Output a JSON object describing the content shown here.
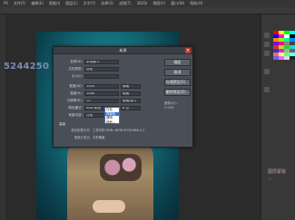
{
  "menu": [
    "PS",
    "文件(F)",
    "编辑(E)",
    "图像(I)",
    "图层(L)",
    "文字(Y)",
    "选择(S)",
    "滤镜(T)",
    "3D(D)",
    "视图(V)",
    "窗口(W)",
    "帮助(H)"
  ],
  "watermark_left": "5244250",
  "right_panel_text": "图层蒙版",
  "right_panel_subtext": "—",
  "dialog": {
    "title": "新建",
    "fields": [
      {
        "label": "名称(N):",
        "value": "未标题-1",
        "unit": ""
      },
      {
        "label": "文档类型:",
        "value": "自定",
        "unit": ""
      },
      {
        "label": "大小(I):",
        "value": "",
        "unit": ""
      },
      {
        "label": "宽度(W):",
        "value": "1920",
        "unit": "像素"
      },
      {
        "label": "高度(H):",
        "value": "1080",
        "unit": "像素"
      },
      {
        "label": "分辨率(R):",
        "value": "72",
        "unit": "像素/英寸"
      },
      {
        "label": "颜色模式:",
        "value": "RGB 颜色",
        "unit": "8 位"
      },
      {
        "label": "背景内容:",
        "value": "白色",
        "unit": ""
      }
    ],
    "buttons": [
      "确定",
      "取消",
      "存储预设(S)...",
      "删除预设(D)..."
    ],
    "dropdown_options": [
      "白色",
      "背景色",
      "透明",
      "其他..."
    ],
    "dropdown_selected_index": 1,
    "advanced_label": "高级",
    "info": [
      {
        "label": "颜色配置文件:",
        "value": "工作中的 RGB: sRGB IEC61966-2.1"
      },
      {
        "label": "像素长宽比:",
        "value": "方形像素"
      }
    ],
    "image_size_label": "图像大小:",
    "image_size_value": "5.93M"
  },
  "colors": {
    "swatches": [
      "#ff0000",
      "#ffff00",
      "#00ff00",
      "#00ffff",
      "#0000ff",
      "#ff00ff",
      "#ffffff",
      "#000000",
      "#ff8800",
      "#88ff00",
      "#00ff88",
      "#0088ff",
      "#8800ff",
      "#ff0088",
      "#888888",
      "#444444",
      "#cc3333",
      "#cccc33",
      "#33cc33",
      "#33cccc",
      "#3333cc",
      "#cc33cc",
      "#aaaaaa",
      "#666666",
      "#ff6666",
      "#ffff66",
      "#66ff66",
      "#66ffff",
      "#6666ff",
      "#ff66ff",
      "#dddddd",
      "#222222"
    ]
  }
}
